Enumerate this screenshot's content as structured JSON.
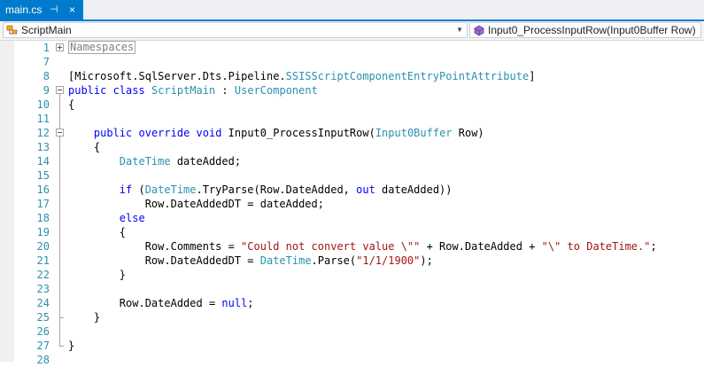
{
  "tab": {
    "title": "main.cs",
    "pin_glyph": "⊣",
    "close_glyph": "×"
  },
  "navbar": {
    "left_label": "ScriptMain",
    "left_icon": "class-icon",
    "right_label": "Input0_ProcessInputRow(Input0Buffer Row)",
    "right_icon": "method-icon",
    "dropdown_glyph": "▼"
  },
  "editor": {
    "collapsed_region": "Namespaces",
    "lines": [
      {
        "num": "1",
        "tokens": []
      },
      {
        "num": "7",
        "tokens": []
      },
      {
        "num": "8",
        "tokens": [
          {
            "t": "[Microsoft.SqlServer.Dts.Pipeline.",
            "c": "p"
          },
          {
            "t": "SSISScriptComponentEntryPointAttribute",
            "c": "ty"
          },
          {
            "t": "]",
            "c": "p"
          }
        ]
      },
      {
        "num": "9",
        "tokens": [
          {
            "t": "public",
            "c": "kw"
          },
          {
            "t": " ",
            "c": "p"
          },
          {
            "t": "class",
            "c": "kw"
          },
          {
            "t": " ",
            "c": "p"
          },
          {
            "t": "ScriptMain",
            "c": "ty"
          },
          {
            "t": " : ",
            "c": "p"
          },
          {
            "t": "UserComponent",
            "c": "ty"
          }
        ]
      },
      {
        "num": "10",
        "tokens": [
          {
            "t": "{",
            "c": "p"
          }
        ]
      },
      {
        "num": "11",
        "tokens": []
      },
      {
        "num": "12",
        "tokens": [
          {
            "t": "    ",
            "c": "p"
          },
          {
            "t": "public",
            "c": "kw"
          },
          {
            "t": " ",
            "c": "p"
          },
          {
            "t": "override",
            "c": "kw"
          },
          {
            "t": " ",
            "c": "p"
          },
          {
            "t": "void",
            "c": "kw"
          },
          {
            "t": " Input0_ProcessInputRow(",
            "c": "p"
          },
          {
            "t": "Input0Buffer",
            "c": "ty"
          },
          {
            "t": " Row)",
            "c": "p"
          }
        ]
      },
      {
        "num": "13",
        "tokens": [
          {
            "t": "    {",
            "c": "p"
          }
        ]
      },
      {
        "num": "14",
        "tokens": [
          {
            "t": "        ",
            "c": "p"
          },
          {
            "t": "DateTime",
            "c": "ty"
          },
          {
            "t": " dateAdded;",
            "c": "p"
          }
        ]
      },
      {
        "num": "15",
        "tokens": []
      },
      {
        "num": "16",
        "tokens": [
          {
            "t": "        ",
            "c": "p"
          },
          {
            "t": "if",
            "c": "kw"
          },
          {
            "t": " (",
            "c": "p"
          },
          {
            "t": "DateTime",
            "c": "ty"
          },
          {
            "t": ".TryParse(Row.DateAdded, ",
            "c": "p"
          },
          {
            "t": "out",
            "c": "kw"
          },
          {
            "t": " dateAdded))",
            "c": "p"
          }
        ]
      },
      {
        "num": "17",
        "tokens": [
          {
            "t": "            Row.DateAddedDT = dateAdded;",
            "c": "p"
          }
        ]
      },
      {
        "num": "18",
        "tokens": [
          {
            "t": "        ",
            "c": "p"
          },
          {
            "t": "else",
            "c": "kw"
          }
        ]
      },
      {
        "num": "19",
        "tokens": [
          {
            "t": "        {",
            "c": "p"
          }
        ]
      },
      {
        "num": "20",
        "tokens": [
          {
            "t": "            Row.Comments = ",
            "c": "p"
          },
          {
            "t": "\"Could not convert value \\\"\"",
            "c": "st"
          },
          {
            "t": " + Row.DateAdded + ",
            "c": "p"
          },
          {
            "t": "\"\\\" to DateTime.\"",
            "c": "st"
          },
          {
            "t": ";",
            "c": "p"
          }
        ]
      },
      {
        "num": "21",
        "tokens": [
          {
            "t": "            Row.DateAddedDT = ",
            "c": "p"
          },
          {
            "t": "DateTime",
            "c": "ty"
          },
          {
            "t": ".Parse(",
            "c": "p"
          },
          {
            "t": "\"1/1/1900\"",
            "c": "st"
          },
          {
            "t": ");",
            "c": "p"
          }
        ]
      },
      {
        "num": "22",
        "tokens": [
          {
            "t": "        }",
            "c": "p"
          }
        ]
      },
      {
        "num": "23",
        "tokens": []
      },
      {
        "num": "24",
        "tokens": [
          {
            "t": "        Row.DateAdded = ",
            "c": "p"
          },
          {
            "t": "null",
            "c": "kw"
          },
          {
            "t": ";",
            "c": "p"
          }
        ]
      },
      {
        "num": "25",
        "tokens": [
          {
            "t": "    }",
            "c": "p"
          }
        ]
      },
      {
        "num": "26",
        "tokens": []
      },
      {
        "num": "27",
        "tokens": [
          {
            "t": "}",
            "c": "p"
          }
        ]
      },
      {
        "num": "28",
        "tokens": []
      }
    ]
  },
  "colors": {
    "accent": "#007acc",
    "keyword": "#0000ff",
    "type": "#2b91af",
    "string": "#a31515",
    "line_number": "#2b91af"
  }
}
